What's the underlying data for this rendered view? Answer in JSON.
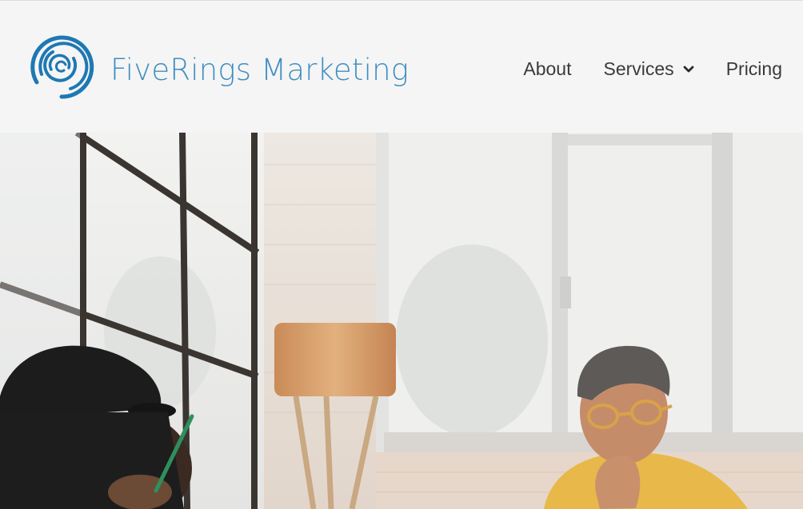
{
  "brand": {
    "name": "FiveRings Marketing",
    "logo_icon": "concentric-rings-logo-icon",
    "color": "#3f8ec0"
  },
  "nav": {
    "items": [
      {
        "label": "About"
      },
      {
        "label": "Services",
        "has_dropdown": true,
        "icon": "chevron-down-icon"
      },
      {
        "label": "Pricing"
      }
    ]
  },
  "hero": {
    "image": "office-meeting-photo"
  }
}
